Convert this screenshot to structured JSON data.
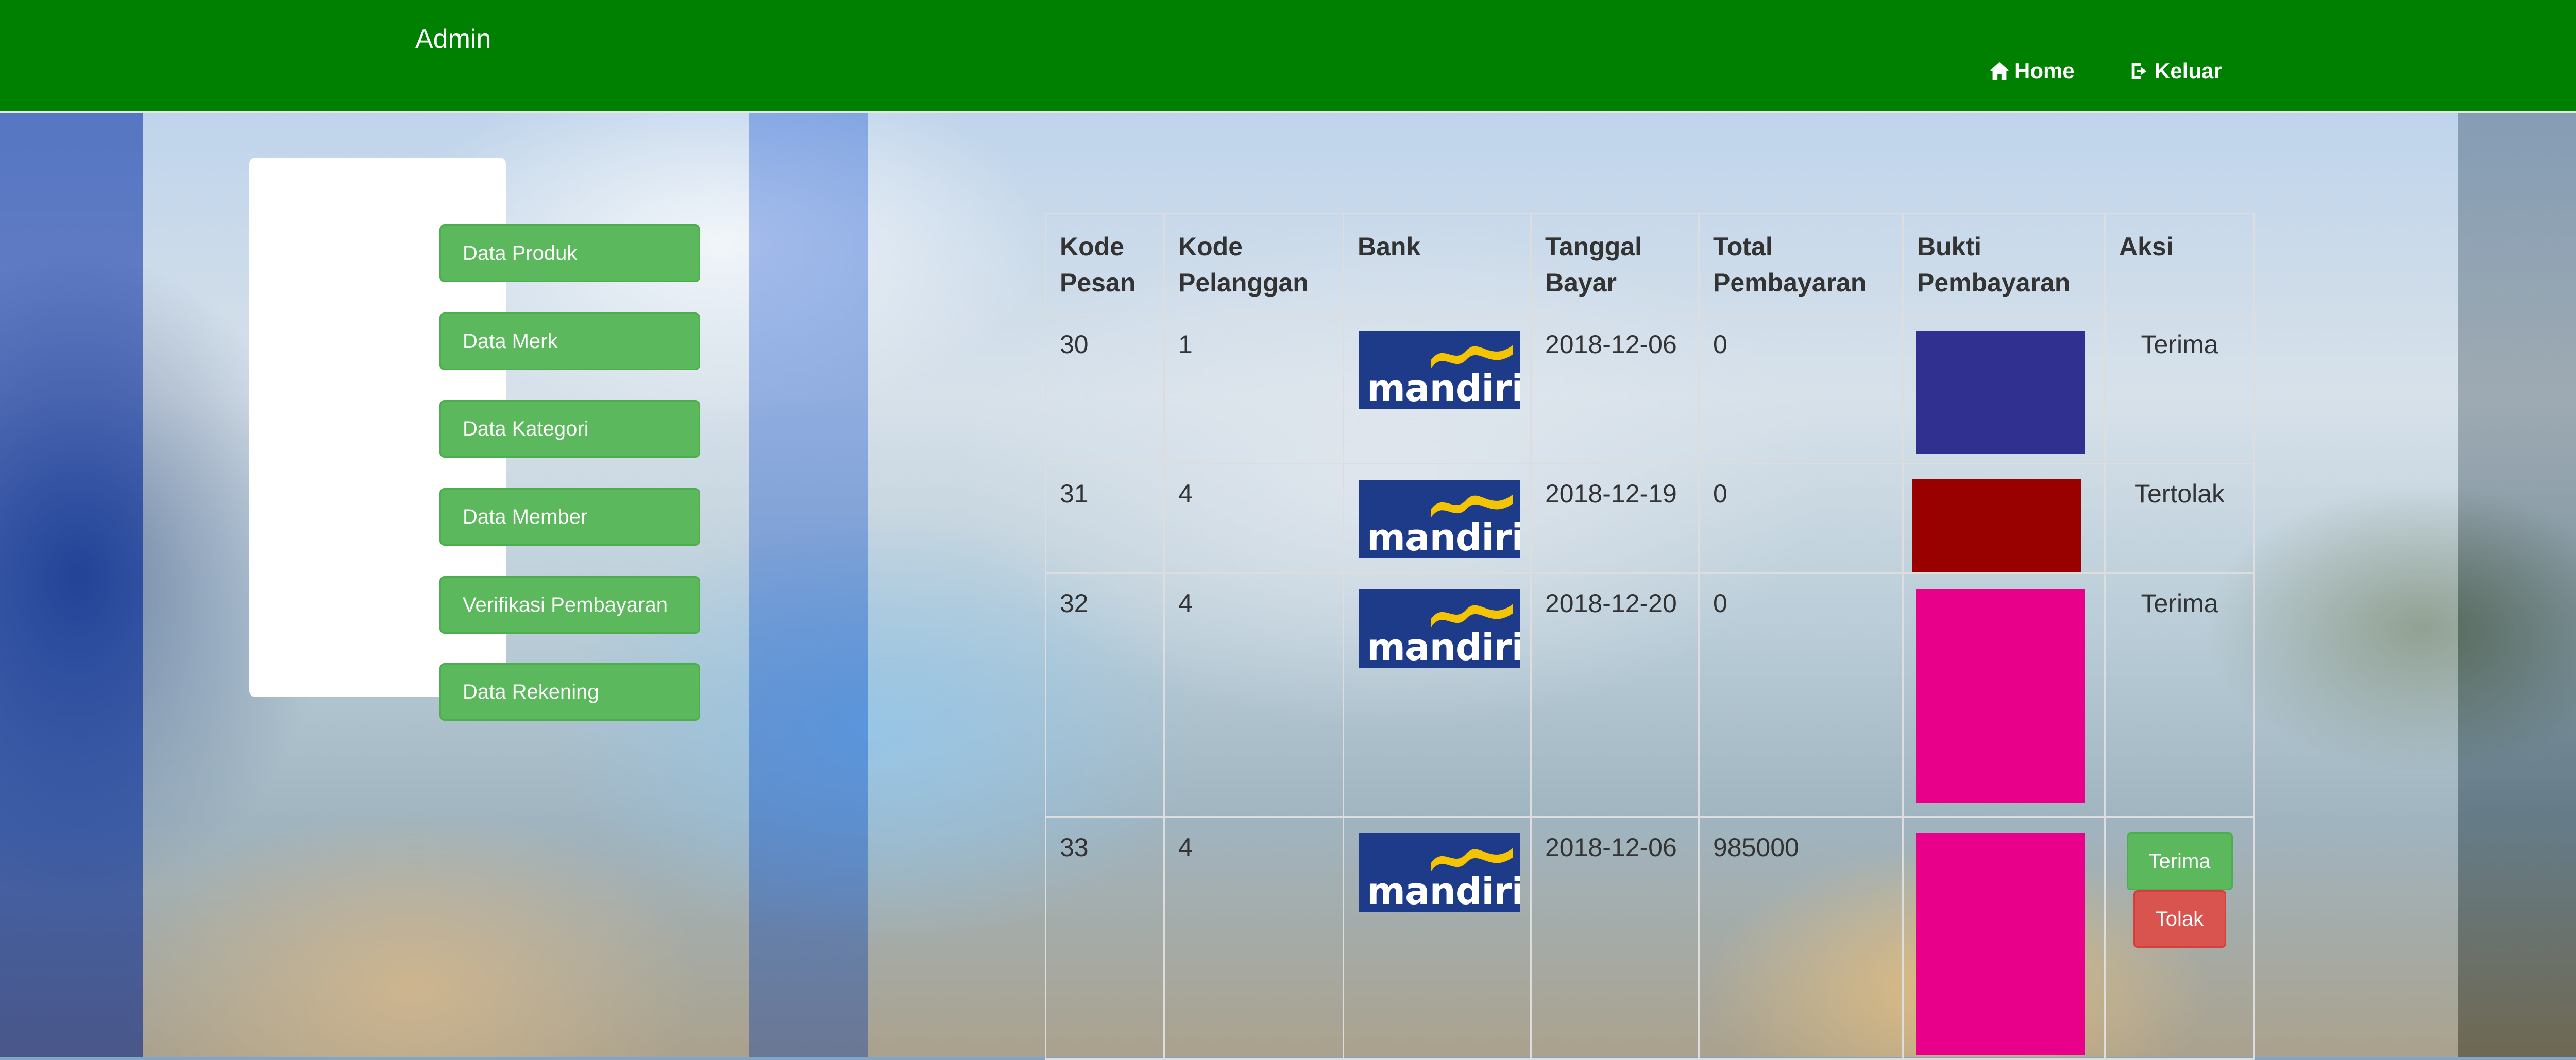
{
  "navbar": {
    "brand": "Admin",
    "home": "Home",
    "logout": "Keluar"
  },
  "sidebar": {
    "items": [
      {
        "label": "Data Produk"
      },
      {
        "label": "Data Merk"
      },
      {
        "label": "Data Kategori"
      },
      {
        "label": "Data Member"
      },
      {
        "label": "Verifikasi Pembayaran"
      },
      {
        "label": "Data Rekening"
      }
    ]
  },
  "table": {
    "headers": [
      "Kode Pesan",
      "Kode Pelanggan",
      "Bank",
      "Tanggal Bayar",
      "Total Pembayaran",
      "Bukti Pembayaran",
      "Aksi"
    ],
    "rows": [
      {
        "kode_pesan": "30",
        "kode_pelanggan": "1",
        "bank": "mandiri",
        "tanggal": "2018-12-06",
        "total": "0",
        "aksi": "Terima"
      },
      {
        "kode_pesan": "31",
        "kode_pelanggan": "4",
        "bank": "mandiri",
        "tanggal": "2018-12-19",
        "total": "0",
        "aksi": "Tertolak"
      },
      {
        "kode_pesan": "32",
        "kode_pelanggan": "4",
        "bank": "mandiri",
        "tanggal": "2018-12-20",
        "total": "0",
        "aksi": "Terima"
      },
      {
        "kode_pesan": "33",
        "kode_pelanggan": "4",
        "bank": "mandiri",
        "tanggal": "2018-12-06",
        "total": "985000",
        "accept_button": "Terima",
        "reject_button": "Tolak"
      }
    ]
  },
  "colors": {
    "navbar": "#008000",
    "button_success": "#5cb85c",
    "button_danger": "#d9534f",
    "bank_logo": "#1e3b8a"
  },
  "icons": {
    "home": "home-icon",
    "logout": "logout-icon"
  }
}
